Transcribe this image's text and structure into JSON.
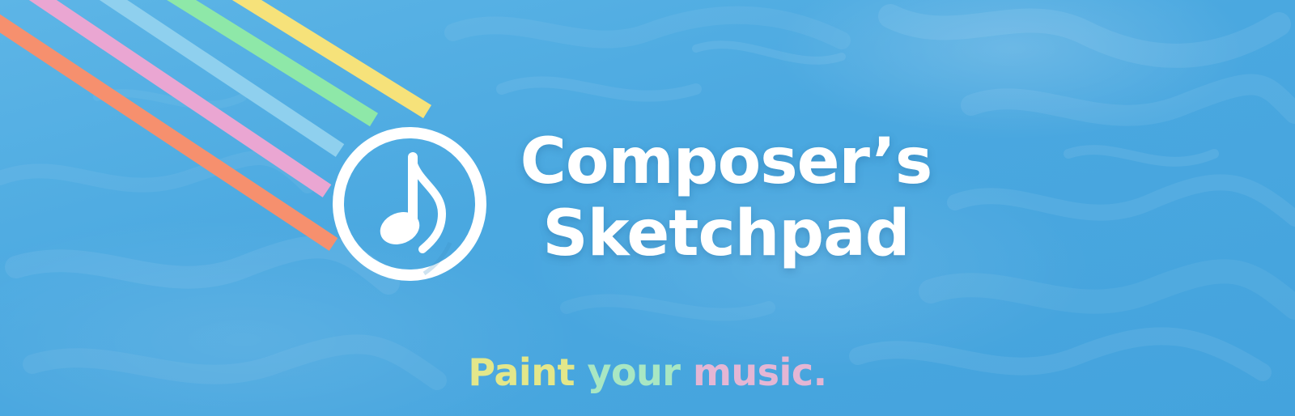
{
  "brand": {
    "title_line_1": "Composer’s",
    "title_line_2": "Sketchpad",
    "logo_icon": "music-note-icon",
    "tagline": [
      {
        "text": "Paint",
        "color": "#e3e78a"
      },
      {
        "text": " ",
        "color": "#ffffff"
      },
      {
        "text": "your",
        "color": "#a8e7c3"
      },
      {
        "text": " ",
        "color": "#ffffff"
      },
      {
        "text": "music.",
        "color": "#e4b6d4"
      }
    ]
  },
  "colors": {
    "background": "#4aa8e0",
    "title": "#ffffff",
    "ray_yellow": "#f6e27a",
    "ray_green": "#8ee8a8",
    "ray_light_blue": "#8fd0ee",
    "ray_pink": "#eaa6d2",
    "ray_orange": "#f6906e"
  }
}
